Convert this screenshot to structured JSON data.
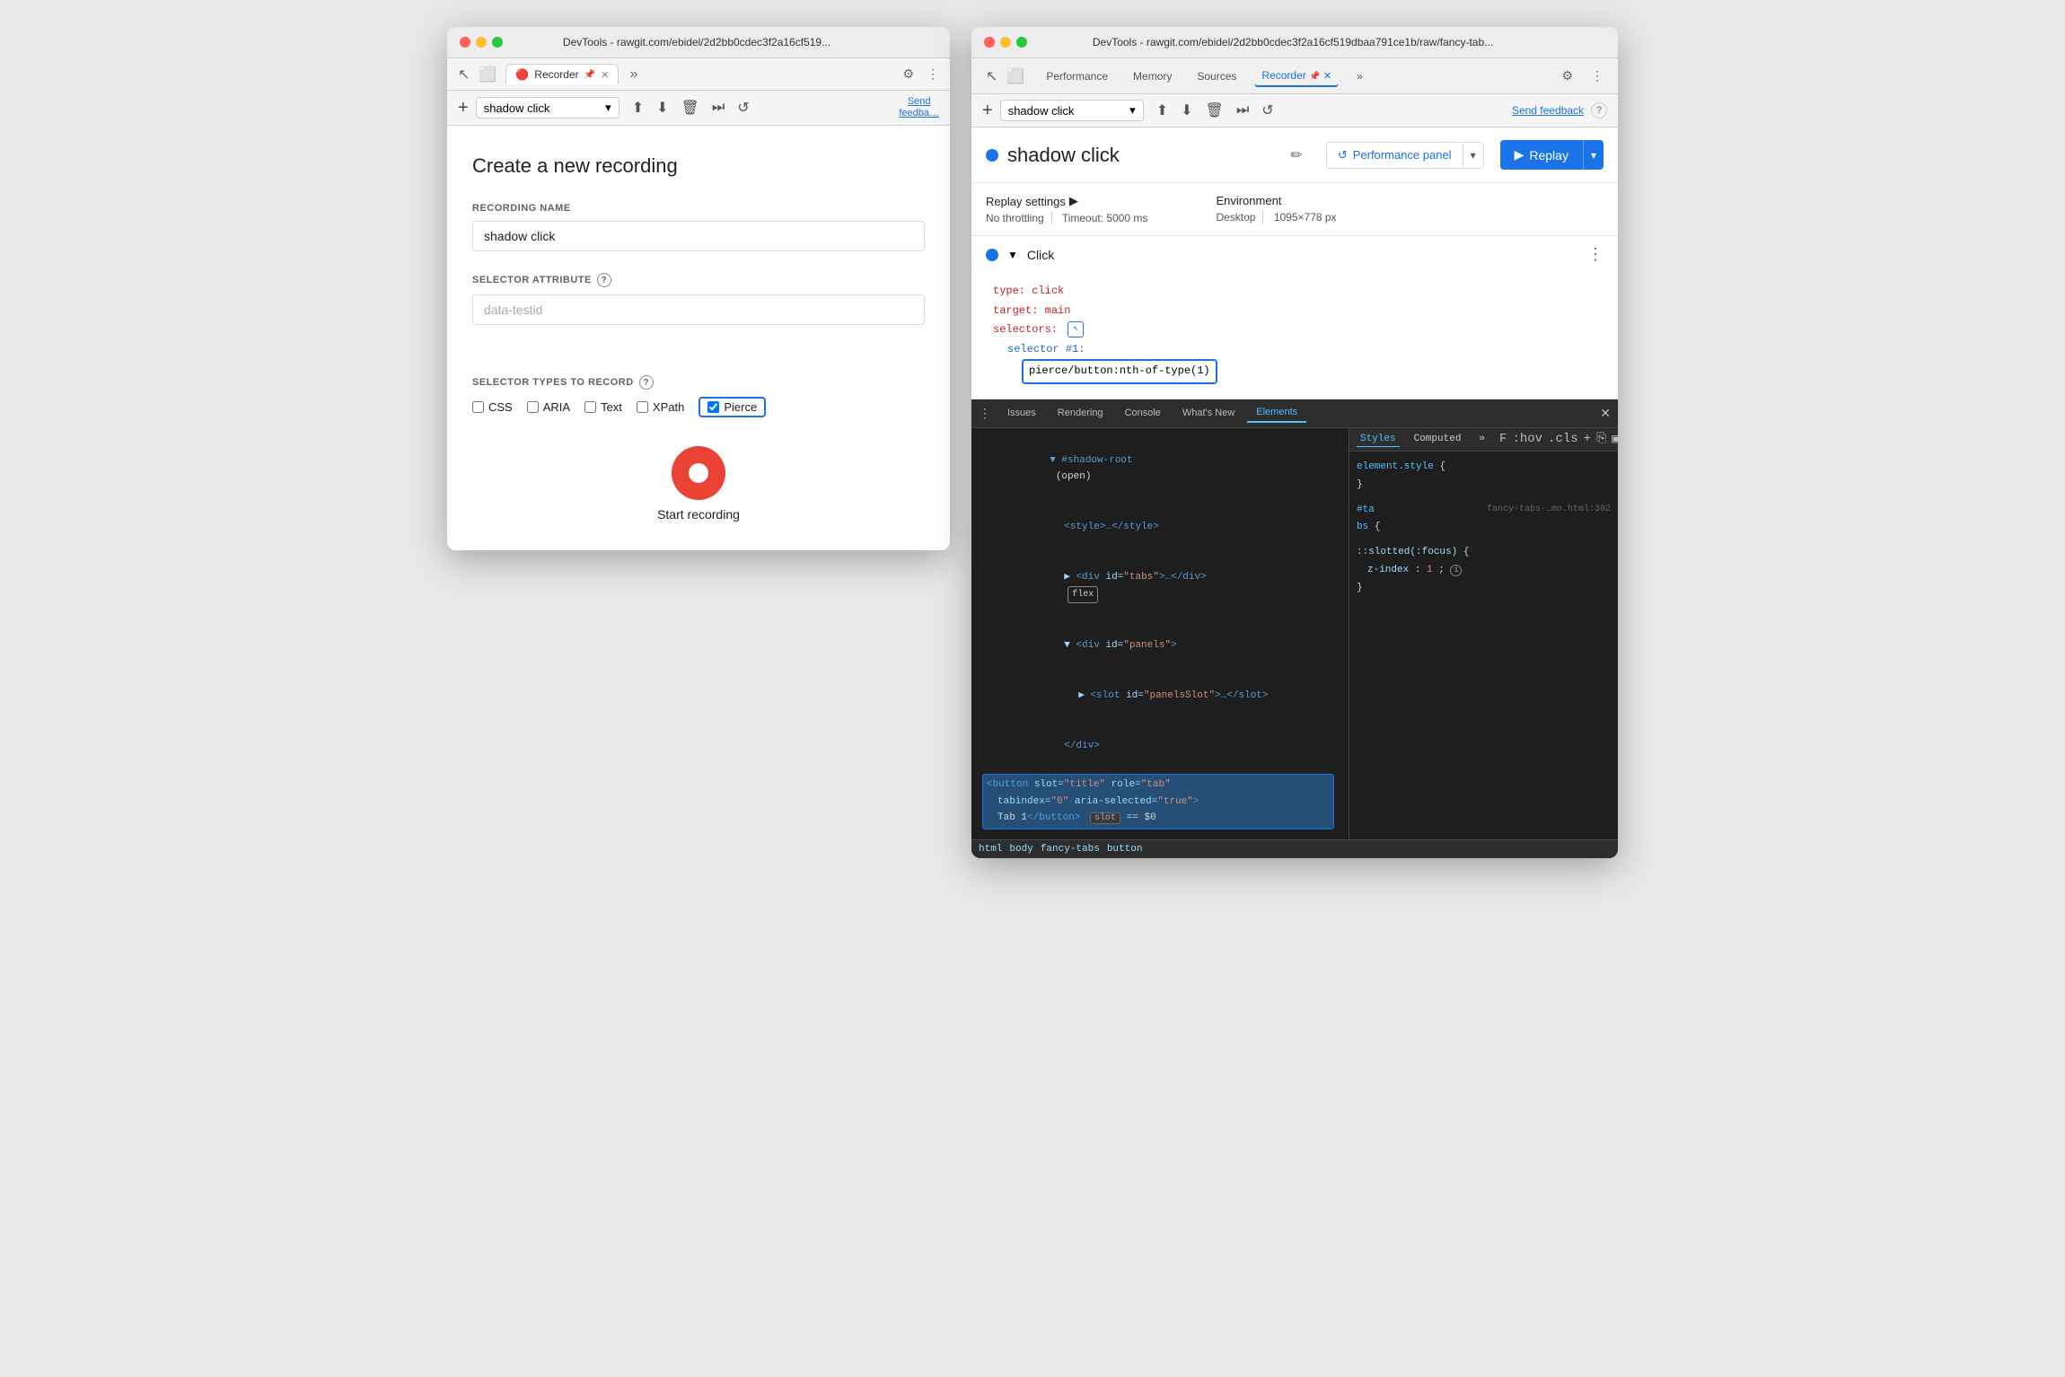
{
  "left_window": {
    "title": "DevTools - rawgit.com/ebidel/2d2bb0cdec3f2a16cf519...",
    "tab_label": "Recorder",
    "tab_icon": "🔴",
    "toolbar": {
      "add_btn": "+",
      "recording_name": "shadow click",
      "send_feedback": "Send\nfeedback"
    },
    "form": {
      "title": "Create a new recording",
      "recording_name_label": "RECORDING NAME",
      "recording_name_value": "shadow click",
      "selector_attr_label": "SELECTOR ATTRIBUTE",
      "selector_attr_placeholder": "data-testid",
      "selector_types_label": "SELECTOR TYPES TO RECORD",
      "checkboxes": [
        {
          "id": "css",
          "label": "CSS",
          "checked": false
        },
        {
          "id": "aria",
          "label": "ARIA",
          "checked": false
        },
        {
          "id": "text",
          "label": "Text",
          "checked": false
        },
        {
          "id": "xpath",
          "label": "XPath",
          "checked": false
        },
        {
          "id": "pierce",
          "label": "Pierce",
          "checked": true
        }
      ],
      "start_recording_label": "Start recording"
    }
  },
  "right_window": {
    "title": "DevTools - rawgit.com/ebidel/2d2bb0cdec3f2a16cf519dbaa791ce1b/raw/fancy-tab...",
    "top_nav": {
      "tabs": [
        "Performance",
        "Memory",
        "Sources",
        "Recorder",
        "»"
      ],
      "active_tab": "Recorder"
    },
    "toolbar": {
      "add_btn": "+",
      "recording_name": "shadow click",
      "send_feedback": "Send feedback",
      "help": "?"
    },
    "recording_header": {
      "name": "shadow click",
      "perf_panel_label": "Performance panel",
      "replay_label": "Replay"
    },
    "replay_settings": {
      "title": "Replay settings",
      "throttling": "No throttling",
      "timeout": "Timeout: 5000 ms",
      "environment_title": "Environment",
      "desktop": "Desktop",
      "resolution": "1095×778 px"
    },
    "click_event": {
      "label": "Click",
      "code": {
        "type_key": "type:",
        "type_val": "click",
        "target_key": "target:",
        "target_val": "main",
        "selectors_key": "selectors:",
        "selector_num_key": "selector #1:",
        "selector_val": "pierce/button:nth-of-type(1)"
      }
    },
    "bottom_panel": {
      "tabs": [
        "Issues",
        "Rendering",
        "Console",
        "What's New",
        "Elements"
      ],
      "active_tab": "Elements",
      "dom": {
        "shadow_root": "▼ #shadow-root",
        "open_tag": "(open)",
        "style_tag": "<style>…</style>",
        "div_tabs": "<div id=\"tabs\">…</div>",
        "flex_badge": "flex",
        "div_panels": "▼<div id=\"panels\">",
        "slot_tag": "▶<slot id=\"panelsSlot\">…</slot>",
        "div_close": "</div>",
        "button_highlighted": "<button slot=\"title\" role=\"tab\"\n  tabindex=\"0\" aria-selected=\"true\">\n  Tab 1</button>",
        "slot_badge": "slot",
        "dollar_zero": "== $0"
      },
      "styles": {
        "tabs": [
          "Styles",
          "Computed",
          "»"
        ],
        "filter_label": "F",
        "hov": ":hov",
        "cls": ".cls",
        "element_style": "element.style {",
        "close_brace": "}",
        "source_file": "fancy-tabs-…mo.html:302",
        "selector": "#ta\nbs",
        "slotted": "::slotted(:focus) {",
        "z_index": "z-index: 1;",
        "close_brace2": "}"
      }
    },
    "breadcrumb": [
      "html",
      "body",
      "fancy-tabs",
      "button"
    ]
  },
  "icons": {
    "chevron_down": "▾",
    "chevron_right": "▶",
    "play": "▶",
    "more": "⋮",
    "close": "✕",
    "edit": "✏",
    "plus": "+",
    "export": "⬆",
    "import": "⬇",
    "delete": "🗑",
    "step": "⏭",
    "replay_circle": "↺",
    "settings": "⚙",
    "more_vert": "⋮",
    "cursor": "↖"
  },
  "colors": {
    "blue": "#1a73e8",
    "red": "#ea4335",
    "code_red": "#c5221f",
    "code_blue": "#1967d2",
    "bg_white": "#ffffff",
    "bg_grey": "#f5f5f5"
  }
}
